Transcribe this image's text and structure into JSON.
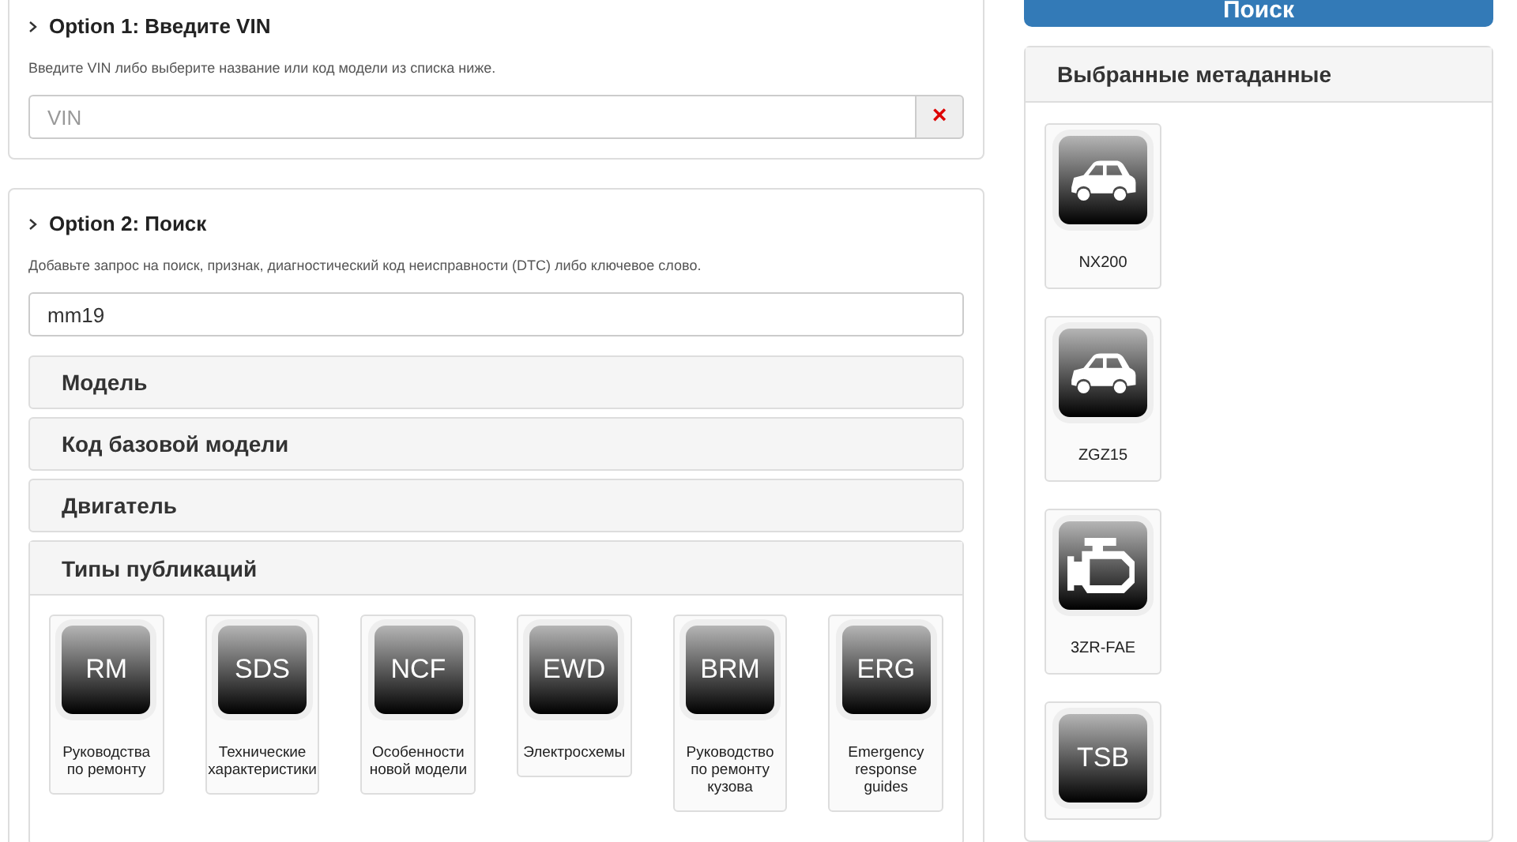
{
  "option1": {
    "title": "Option 1: Введите VIN",
    "description": "Введите VIN либо выберите название или код модели из списка ниже.",
    "vin_field": {
      "placeholder": "VIN"
    },
    "clear_button": "×"
  },
  "option2": {
    "title": "Option 2: Поиск",
    "description": "Добавьте запрос на поиск, признак, диагностический код неисправности (DTC) либо ключевое слово.",
    "search_field": {
      "value": "mm19"
    },
    "filters": [
      {
        "label": "Модель",
        "expanded": false
      },
      {
        "label": "Код базовой модели",
        "expanded": false
      },
      {
        "label": "Двигатель",
        "expanded": false
      },
      {
        "label": "Типы публикаций",
        "expanded": true
      }
    ],
    "publication_types": [
      {
        "code": "RM",
        "label": "Руководства по ремонту"
      },
      {
        "code": "SDS",
        "label": "Технические характеристики"
      },
      {
        "code": "NCF",
        "label": "Особенности новой модели"
      },
      {
        "code": "EWD",
        "label": "Электросхемы"
      },
      {
        "code": "BRM",
        "label": "Руководство по ремонту кузова"
      },
      {
        "code": "ERG",
        "label": "Emergency response guides"
      }
    ]
  },
  "search_button": "Поиск",
  "selected_metadata": {
    "title": "Выбранные метаданные",
    "items": [
      {
        "kind": "car",
        "label": "NX200"
      },
      {
        "kind": "car",
        "label": "ZGZ15"
      },
      {
        "kind": "engine",
        "label": "3ZR-FAE"
      },
      {
        "kind": "text",
        "code": "TSB"
      }
    ]
  }
}
